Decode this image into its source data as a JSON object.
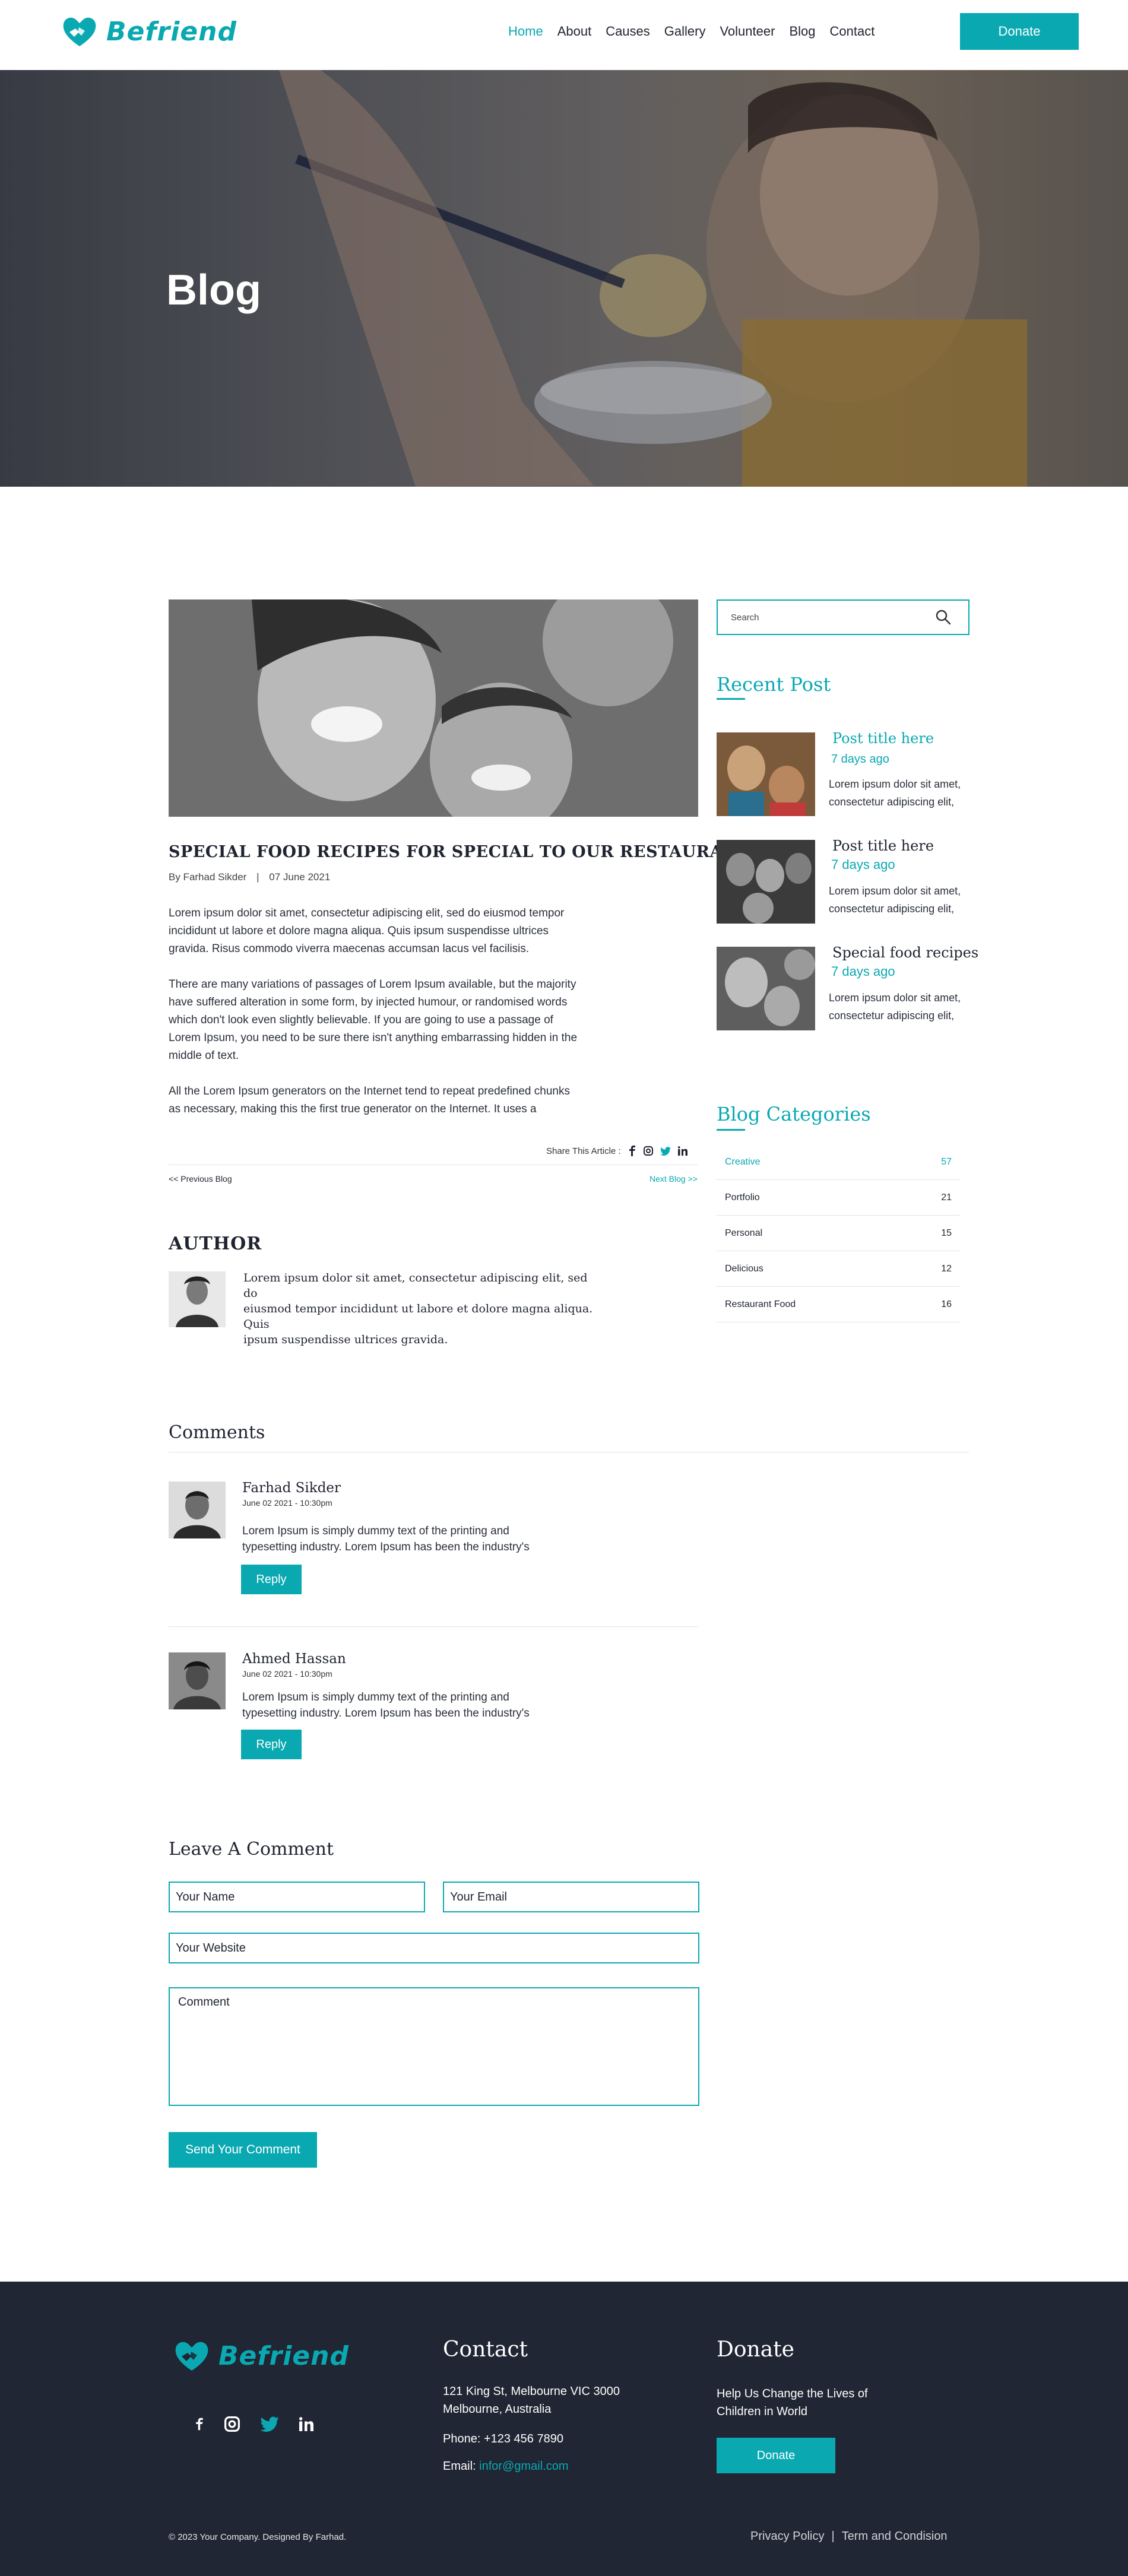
{
  "header": {
    "brand": "Befriend",
    "nav": [
      "Home",
      "About",
      "Causes",
      "Gallery",
      "Volunteer",
      "Blog",
      "Contact"
    ],
    "donate_label": "Donate"
  },
  "hero": {
    "title": "Blog"
  },
  "post": {
    "title": "SPECIAL FOOD RECIPES FOR SPECIAL TO OUR RESTAURANT",
    "author": "By Farhad Sikder",
    "separator": "|",
    "date": "07 June  2021",
    "p1_lines": [
      "Lorem ipsum dolor sit amet, consectetur adipiscing elit, sed do eiusmod tempor",
      "incididunt ut labore et dolore magna aliqua. Quis ipsum suspendisse ultrices",
      "gravida. Risus commodo viverra maecenas accumsan lacus vel facilisis."
    ],
    "p2_lines": [
      "There are many variations of passages of Lorem Ipsum available, but the majority",
      "have suffered alteration in some form, by injected humour, or randomised words",
      "which don't look even slightly believable. If you are going to use a passage of",
      "Lorem Ipsum, you need to be sure there isn't anything embarrassing hidden in the",
      "middle of text."
    ],
    "p3_lines": [
      "All the Lorem Ipsum generators on the Internet tend to repeat predefined chunks",
      "as necessary, making this the first true generator on the Internet. It uses a"
    ],
    "share_label": "Share This Article :",
    "prev_label": "<< Previous Blog",
    "next_label": "Next Blog >>"
  },
  "author_box": {
    "heading": "AUTHOR",
    "lines": [
      "Lorem ipsum dolor sit amet, consectetur adipiscing elit, sed do",
      "eiusmod tempor incididunt ut labore et dolore magna aliqua. Quis",
      "ipsum suspendisse ultrices gravida."
    ]
  },
  "comments": {
    "heading": "Comments",
    "items": [
      {
        "name": "Farhad Sikder",
        "date": "June 02 2021 -  10:30pm",
        "line1": "Lorem Ipsum is simply dummy text of the printing and",
        "line2": "typesetting industry. Lorem Ipsum has been the industry's",
        "reply": "Reply"
      },
      {
        "name": "Ahmed Hassan",
        "date": "June 02 2021 -  10:30pm",
        "line1": "Lorem Ipsum is simply dummy text of the printing and",
        "line2": "typesetting industry. Lorem Ipsum has been the industry's",
        "reply": "Reply"
      }
    ]
  },
  "leave_comment": {
    "heading": "Leave A Comment",
    "name_placeholder": "Your Name",
    "email_placeholder": "Your Email",
    "website_placeholder": "Your Website",
    "comment_placeholder": "Comment",
    "send_label": "Send Your Comment"
  },
  "sidebar": {
    "search_placeholder": "Search",
    "recent_heading": "Recent  Post",
    "recent": [
      {
        "title": "Post title here",
        "ago": "7 days ago",
        "line1": "Lorem ipsum dolor sit amet,",
        "line2": "consectetur adipiscing elit,"
      },
      {
        "title": "Post title here",
        "ago": "7 days ago",
        "line1": "Lorem ipsum dolor sit amet,",
        "line2": "consectetur adipiscing elit,"
      },
      {
        "title": "Special food recipes",
        "ago": "7 days ago",
        "line1": "Lorem ipsum dolor sit amet,",
        "line2": "consectetur adipiscing elit,"
      }
    ],
    "categories_heading": "Blog Categories",
    "categories": [
      {
        "name": "Creative",
        "count": "57"
      },
      {
        "name": "Portfolio",
        "count": "21"
      },
      {
        "name": "Personal",
        "count": "15"
      },
      {
        "name": "Delicious",
        "count": "12"
      },
      {
        "name": "Restaurant Food",
        "count": "16"
      }
    ]
  },
  "footer": {
    "brand": "Befriend",
    "contact_heading": "Contact",
    "address1": "121 King St, Melbourne VIC 3000",
    "address2": "Melbourne, Australia",
    "phone": "Phone: +123 456 7890",
    "email_label": "Email:",
    "email": "infor@gmail.com",
    "donate_heading": "Donate",
    "donate_line1": "Help Us Change the Lives of",
    "donate_line2": "Children in World",
    "donate_button": "Donate",
    "copyright": "© 2023 Your Company. Designed By Farhad.",
    "privacy": "Privacy Policy",
    "pipe": "|",
    "terms": "Term and Condision"
  },
  "colors": {
    "accent": "#0aa9b2",
    "footer_bg": "#202633",
    "text": "#1f2430"
  },
  "icons": [
    "logo-heart-hands-icon",
    "search-icon",
    "facebook-icon",
    "instagram-icon",
    "twitter-icon",
    "linkedin-icon"
  ]
}
